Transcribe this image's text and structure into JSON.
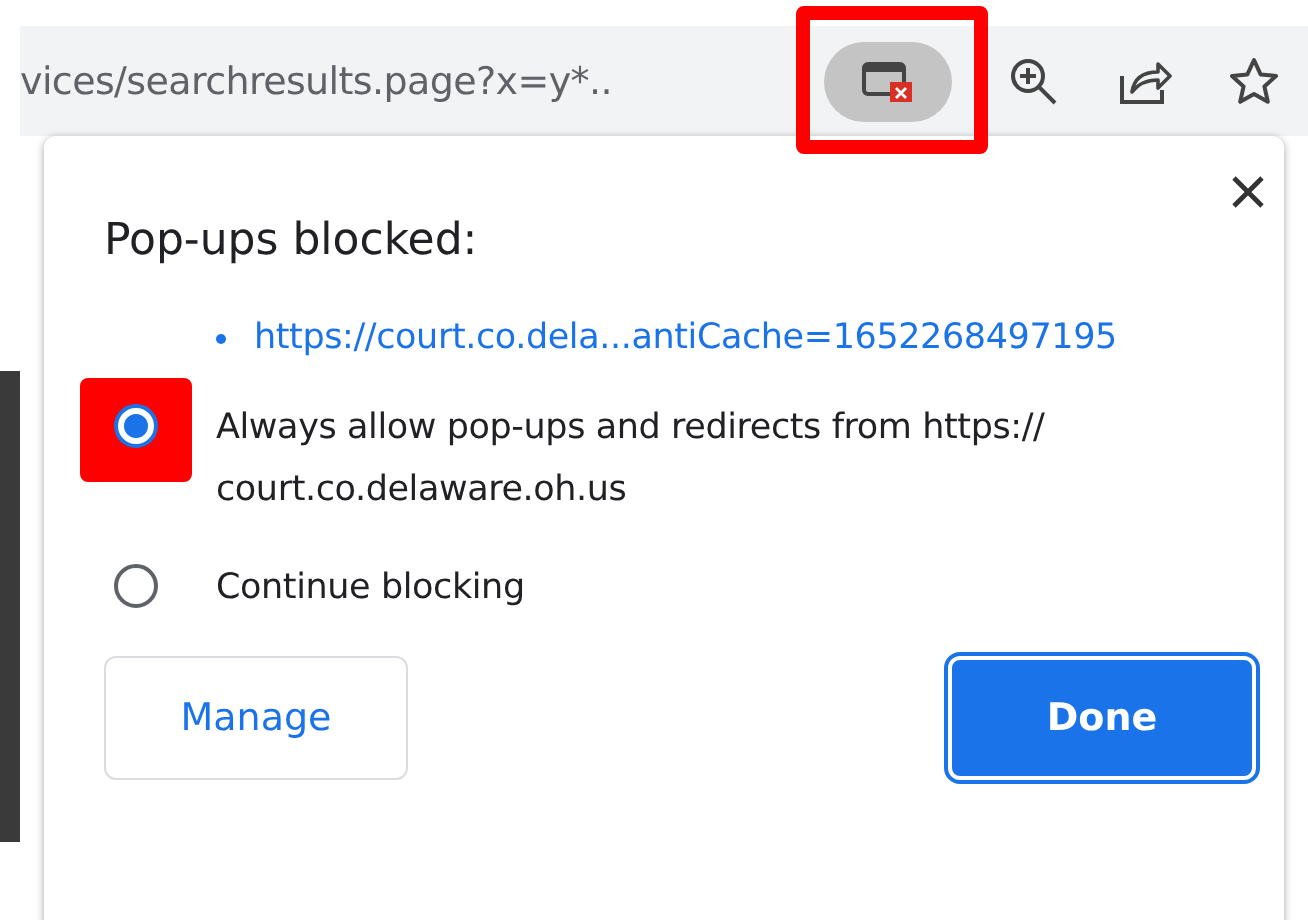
{
  "address_bar": {
    "url": "vices/searchresults.page?x=y*.."
  },
  "dialog": {
    "title": "Pop-ups blocked:",
    "blocked_links": [
      "https://court.co.dela...antiCache=1652268497195"
    ],
    "options": [
      {
        "label": "Always allow pop-ups and redirects from https:// court.co.delaware.oh.us",
        "selected": true,
        "highlighted": true
      },
      {
        "label": "Continue blocking",
        "selected": false,
        "highlighted": false
      }
    ],
    "buttons": [
      {
        "label": "Manage",
        "kind": "secondary"
      },
      {
        "label": "Done",
        "kind": "primary"
      }
    ]
  },
  "popup_icon_highlighted": true
}
